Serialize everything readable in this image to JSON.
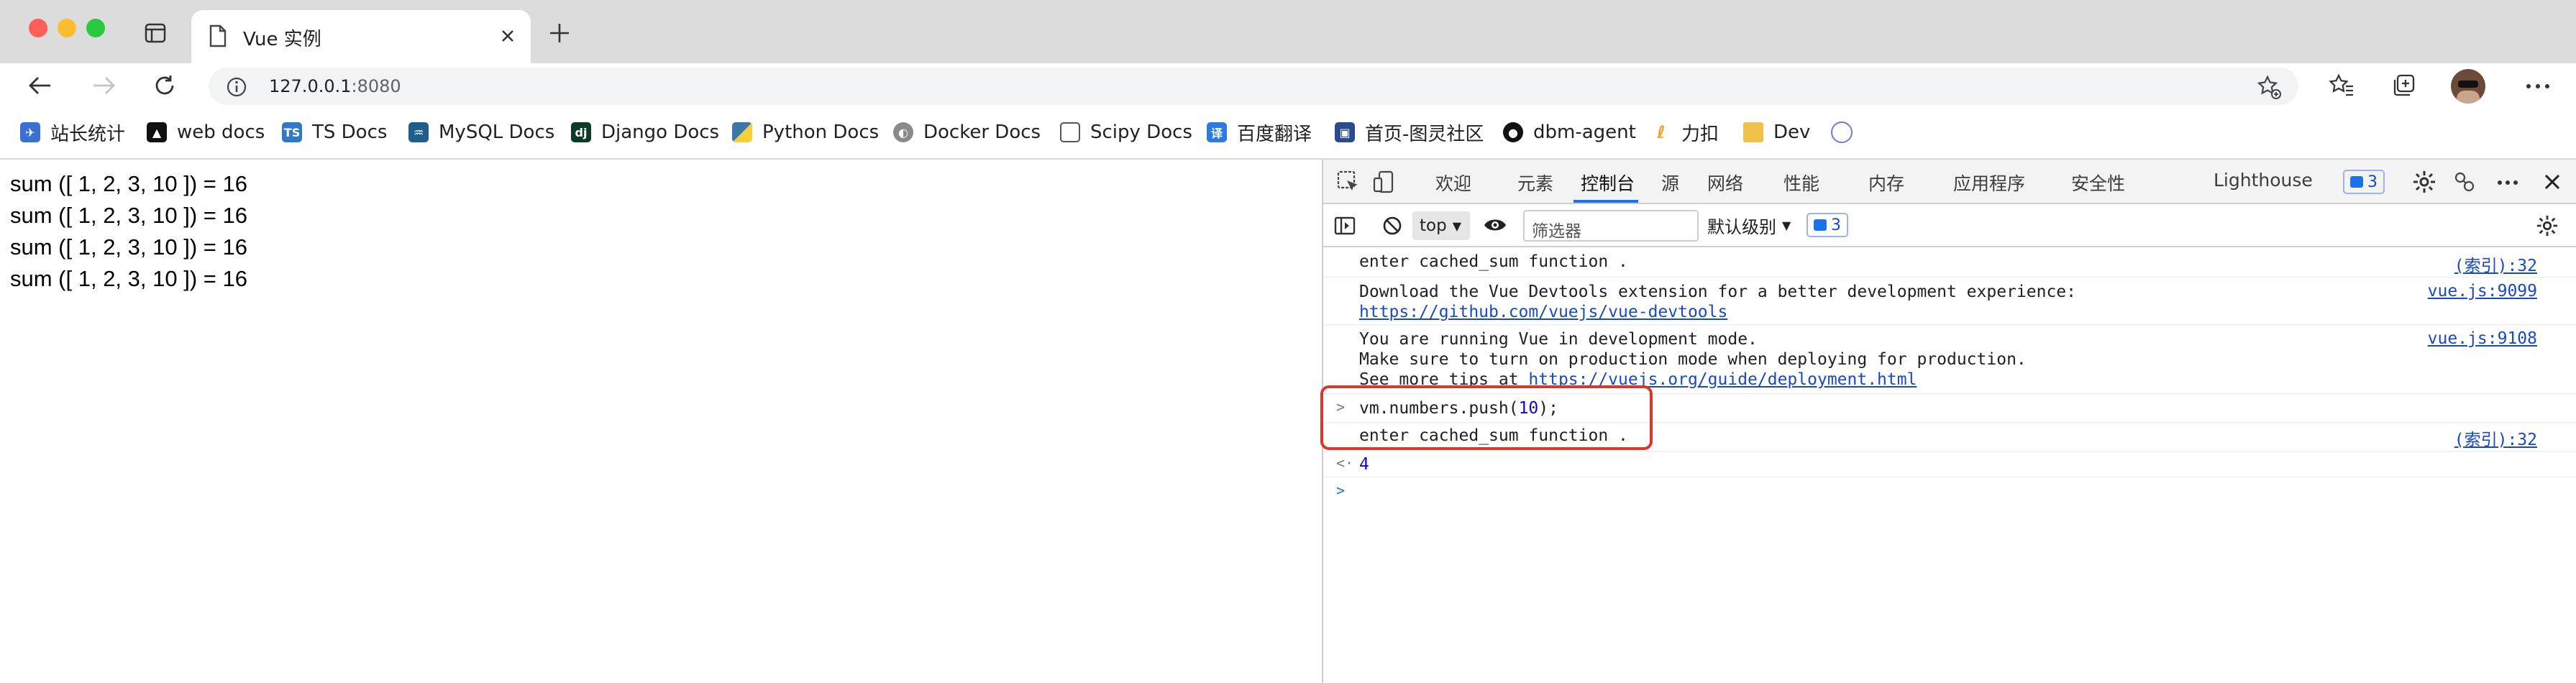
{
  "tab": {
    "title": "Vue 实例"
  },
  "address": {
    "host": "127.0.0.1",
    "port": ":8080"
  },
  "bookmarks": [
    {
      "label": "站长统计",
      "icon": "site-stats-icon",
      "color": "#3b6fd1"
    },
    {
      "label": "web docs",
      "icon": "mdn-icon",
      "color": "#111111"
    },
    {
      "label": "TS Docs",
      "icon": "typescript-icon",
      "color": "#3178c6"
    },
    {
      "label": "MySQL Docs",
      "icon": "mysql-icon",
      "color": "#1f5e8c"
    },
    {
      "label": "Django Docs",
      "icon": "django-icon",
      "color": "#0c3c26"
    },
    {
      "label": "Python Docs",
      "icon": "python-icon",
      "color": "#3b77a8"
    },
    {
      "label": "Docker Docs",
      "icon": "docker-icon",
      "color": "#8a8a8a"
    },
    {
      "label": "Scipy Docs",
      "icon": "page-icon",
      "color": "#ffffff"
    },
    {
      "label": "百度翻译",
      "icon": "baidu-translate-icon",
      "color": "#2b7be0"
    },
    {
      "label": "首页-图灵社区",
      "icon": "turing-icon",
      "color": "#2c4b8c"
    },
    {
      "label": "dbm-agent",
      "icon": "github-icon",
      "color": "#111111"
    },
    {
      "label": "力扣",
      "icon": "leetcode-icon",
      "color": "#f0a020"
    },
    {
      "label": "Dev",
      "icon": "folder-icon",
      "color": "#f1c24a"
    }
  ],
  "page": {
    "lines": [
      "sum ([ 1, 2, 3, 10 ]) = 16",
      "sum ([ 1, 2, 3, 10 ]) = 16",
      "sum ([ 1, 2, 3, 10 ]) = 16",
      "sum ([ 1, 2, 3, 10 ]) = 16"
    ]
  },
  "devtools": {
    "tabs": [
      "欢迎",
      "元素",
      "控制台",
      "源",
      "网络",
      "性能",
      "内存",
      "应用程序",
      "安全性",
      "Lighthouse"
    ],
    "active_tab": "控制台",
    "issues_count": "3",
    "context": "top",
    "filter_placeholder": "筛选器",
    "level": "默认级别",
    "level_count": "3",
    "console": {
      "l1": {
        "text": "enter cached_sum function .",
        "src": "(索引):32"
      },
      "l2": {
        "text": "Download the Vue Devtools extension for a better development experience:",
        "link": "https://github.com/vuejs/vue-devtools",
        "src": "vue.js:9099"
      },
      "l3": {
        "a": "You are running Vue in development mode.",
        "b": "Make sure to turn on production mode when deploying for production.",
        "c": "See more tips at ",
        "link": "https://vuejs.org/guide/deployment.html",
        "src": "vue.js:9108"
      },
      "input": {
        "pre": "vm.numbers.push(",
        "num": "10",
        "post": ");"
      },
      "l4": {
        "text": "enter cached_sum function .",
        "src": "(索引):32"
      },
      "result": "4"
    }
  }
}
